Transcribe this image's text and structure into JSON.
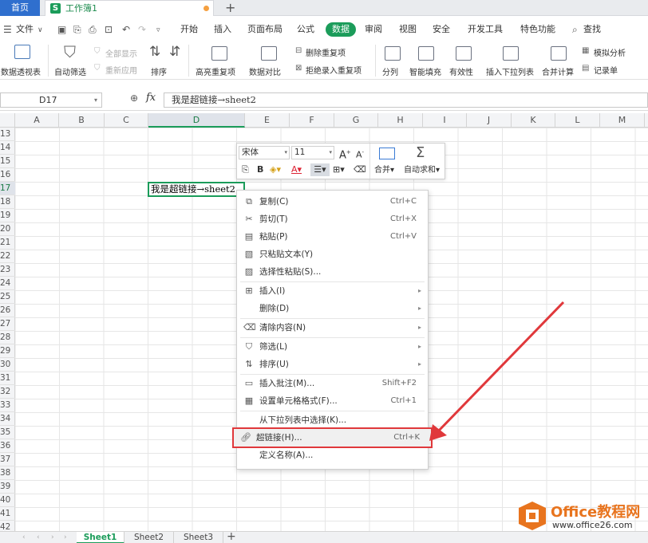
{
  "titlebar": {
    "home_tab": "首页",
    "workbook_tab": "工作簿1",
    "new_tab": "+"
  },
  "menubar": {
    "file": "文件",
    "items": [
      "开始",
      "插入",
      "页面布局",
      "公式",
      "数据",
      "审阅",
      "视图",
      "安全",
      "开发工具",
      "特色功能"
    ],
    "active": "数据",
    "search": "查找"
  },
  "ribbon": {
    "pivot": "数据透视表",
    "autofilter": "自动筛选",
    "show_all": "全部显示",
    "reapply": "重新应用",
    "sort": "排序",
    "highlight_dup": "高亮重复项",
    "compare": "数据对比",
    "delete_dup": "删除重复项",
    "reject_dup": "拒绝录入重复项",
    "split": "分列",
    "smart_fill": "智能填充",
    "validity": "有效性",
    "dropdown_list": "插入下拉列表",
    "merge_calc": "合并计算",
    "whatif": "模拟分析",
    "record": "记录单"
  },
  "formulabar": {
    "cell_ref": "D17",
    "fx": "fx",
    "content": "我是超链接→sheet2"
  },
  "grid": {
    "columns": [
      "A",
      "B",
      "C",
      "D",
      "E",
      "F",
      "G",
      "H",
      "I",
      "J",
      "K",
      "L",
      "M"
    ],
    "selected_column": "D",
    "rows": [
      "13",
      "14",
      "15",
      "16",
      "17",
      "18",
      "19",
      "20",
      "21",
      "22",
      "23",
      "24",
      "25",
      "26",
      "27",
      "28",
      "29",
      "30",
      "31",
      "32",
      "33",
      "34",
      "35",
      "36",
      "37",
      "38",
      "39",
      "40",
      "41",
      "42"
    ],
    "selected_row": "17",
    "active_cell_text": "我是超链接→sheet2"
  },
  "minitoolbar": {
    "font": "宋体",
    "size": "11",
    "bold": "B",
    "merge": "合并",
    "autosum": "自动求和"
  },
  "context_menu": [
    {
      "label": "复制(C)",
      "shortcut": "Ctrl+C",
      "icon": "copy-icon"
    },
    {
      "label": "剪切(T)",
      "shortcut": "Ctrl+X",
      "icon": "scissors-icon"
    },
    {
      "label": "粘贴(P)",
      "shortcut": "Ctrl+V",
      "icon": "paste-icon"
    },
    {
      "label": "只粘贴文本(Y)",
      "shortcut": "",
      "icon": "paste-text-icon"
    },
    {
      "label": "选择性粘贴(S)...",
      "shortcut": "",
      "icon": "paste-special-icon"
    },
    {
      "label": "插入(I)",
      "shortcut": "",
      "icon": "insert-icon",
      "submenu": true
    },
    {
      "label": "删除(D)",
      "shortcut": "",
      "icon": "",
      "submenu": true
    },
    {
      "label": "清除内容(N)",
      "shortcut": "",
      "icon": "eraser-icon",
      "submenu": true
    },
    {
      "label": "筛选(L)",
      "shortcut": "",
      "icon": "filter-icon",
      "submenu": true
    },
    {
      "label": "排序(U)",
      "shortcut": "",
      "icon": "sort-icon",
      "submenu": true
    },
    {
      "label": "插入批注(M)...",
      "shortcut": "Shift+F2",
      "icon": "comment-icon"
    },
    {
      "label": "设置单元格格式(F)...",
      "shortcut": "Ctrl+1",
      "icon": "format-cells-icon"
    },
    {
      "label": "从下拉列表中选择(K)...",
      "shortcut": "",
      "icon": ""
    },
    {
      "label": "超链接(H)...",
      "shortcut": "Ctrl+K",
      "icon": "link-icon"
    },
    {
      "label": "定义名称(A)...",
      "shortcut": "",
      "icon": ""
    }
  ],
  "sheets": [
    "Sheet1",
    "Sheet2",
    "Sheet3"
  ],
  "active_sheet": "Sheet1",
  "add_sheet": "+",
  "watermark": {
    "line1": "Office教程网",
    "line2": "www.office26.com"
  },
  "colors": {
    "accent_green": "#1b9c5a",
    "home_blue": "#2f6fce",
    "highlight_red": "#e0383b",
    "watermark_orange": "#e8741e"
  }
}
